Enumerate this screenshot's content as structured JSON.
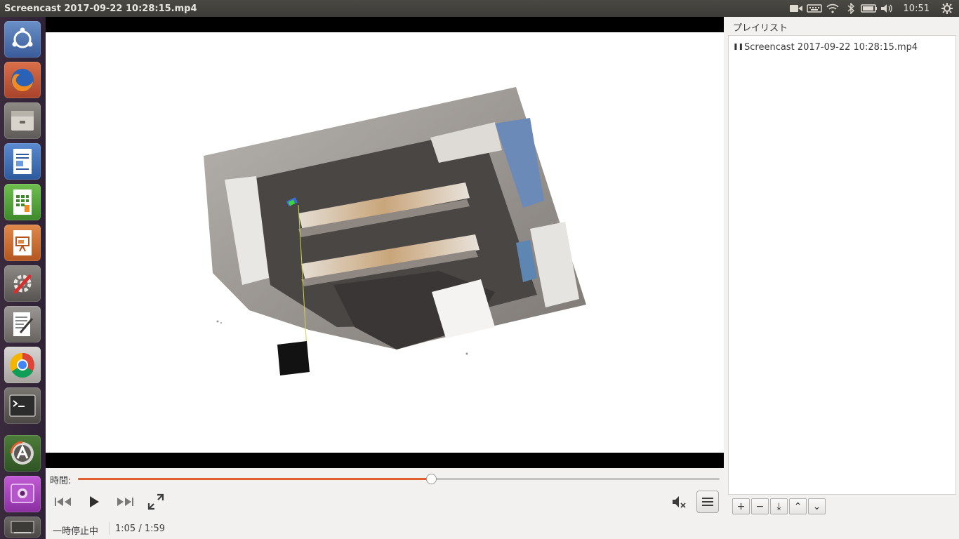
{
  "window": {
    "title": "Screencast 2017-09-22 10:28:15.mp4"
  },
  "topbar": {
    "clock": "10:51",
    "icons": [
      "video-record-icon",
      "keyboard-icon",
      "wifi-icon",
      "bluetooth-icon",
      "battery-icon",
      "volume-icon",
      "settings-gear-icon"
    ]
  },
  "launcher": {
    "items": [
      "ubuntu-dash",
      "firefox",
      "files",
      "libreoffice-writer",
      "libreoffice-calc",
      "libreoffice-impress",
      "system-settings",
      "text-editor",
      "chrome",
      "terminal",
      "software-updater",
      "webcam-app",
      "more"
    ]
  },
  "player": {
    "time_label": "時間:",
    "progress": 0.55,
    "status": "一時停止中",
    "position": "1:05 / 1:59"
  },
  "playlist": {
    "title": "プレイリスト",
    "items": [
      {
        "state": "❚❚",
        "name": "Screencast 2017-09-22 10:28:15.mp4"
      }
    ],
    "buttons": [
      "+",
      "−",
      "⤓",
      "⌃",
      "⌄"
    ]
  },
  "colors": {
    "accent": "#e05e2e",
    "topbar": "#3c3b37",
    "launcher": "#2f2236"
  }
}
